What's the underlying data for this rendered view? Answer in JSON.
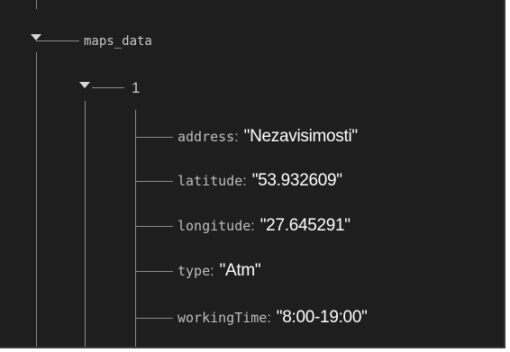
{
  "tree": {
    "node": {
      "key": "maps_data",
      "child": {
        "key": "1",
        "fields": [
          {
            "key": "address",
            "value": "\"Nezavisimosti\""
          },
          {
            "key": "latitude",
            "value": "\"53.932609\""
          },
          {
            "key": "longitude",
            "value": "\"27.645291\""
          },
          {
            "key": "type",
            "value": "\"Atm\""
          },
          {
            "key": "workingTime",
            "value": "\"8:00-19:00\""
          }
        ]
      }
    },
    "separator": ":"
  }
}
